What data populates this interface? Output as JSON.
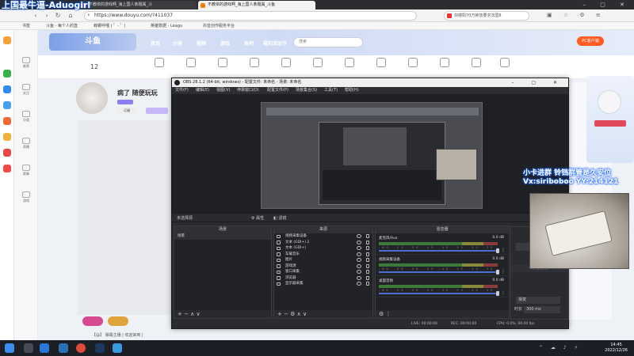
{
  "overlay": {
    "top_left_text": "上国最牛逼-Aduogirl",
    "cam_caption_line1": "小卡进群 铃铛群管是久安位",
    "cam_caption_line2": "Vx:siriboboo YY:214121"
  },
  "browser": {
    "tabs": [
      {
        "label": "不教依的游戏啊_海上国人条题属_斗"
      },
      {
        "label": "不教依的游戏啊_海上国人条题属_斗鱼"
      }
    ],
    "url": "https://www.douyu.com/?411037",
    "search_box": "剑楼阳70万钟放要求法国8",
    "bookmarks": [
      "书签",
      "斗鱼 - 每个人的直",
      "蝉螺呼哩 ( ゜- ゜)",
      "英雄数据 - Leagu",
      "抖音创作服务平台"
    ]
  },
  "douyu": {
    "nav": [
      "首页",
      "分类",
      "视频",
      "游戏",
      "鱼吧",
      "福利活动节"
    ],
    "search_placeholder": "搜索",
    "pc_download": "PC客户端",
    "sidebar": [
      "推荐",
      "关注",
      "分类",
      "直播",
      "赛事",
      "游戏",
      "视频"
    ],
    "level": "12",
    "stream_title": "病了 随便玩玩",
    "tool_labels": [
      "",
      "",
      "",
      "",
      "",
      "",
      "",
      "",
      "",
      "",
      "",
      "",
      "",
      "",
      ""
    ],
    "follow_label": "订阅",
    "bottom_bar": "【@】 弹幕主播 | 欢迎来到 |"
  },
  "obs": {
    "title": "OBS 28.1.2 (64-bit, windows) - 配置文件: 未命名 - 场景: 未命名",
    "menu": [
      "文件(F)",
      "编辑(E)",
      "视图(V)",
      "停靠窗口(D)",
      "配置文件(P)",
      "场景集合(S)",
      "工具(T)",
      "帮助(H)"
    ],
    "source_bar": "未选择源",
    "props_label": "属性",
    "filters_label": "滤镜",
    "docks": {
      "scenes": {
        "title": "场景",
        "items": [
          "场景"
        ]
      },
      "sources": {
        "title": "来源",
        "items": [
          "视频采集设备",
          "文本 (GDI+) 2",
          "文本 (GDI+)",
          "车载音乐",
          "图片",
          "游戏源",
          "窗口采集",
          "浏览器",
          "显示器采集"
        ]
      },
      "mixer": {
        "title": "混音器",
        "channels": [
          {
            "name": "麦克风/Aux",
            "db": "0.0 dB"
          },
          {
            "name": "视频采集设备",
            "db": "0.0 dB"
          },
          {
            "name": "桌面音频",
            "db": "0.0 dB"
          }
        ],
        "ticks": "-60 -55 -50 -45 -40 -35 -30 -25 -20 -15 -10 -5 0"
      },
      "controls": {
        "exit": "退出",
        "transition": "转场特效",
        "fade": "渐变",
        "duration_label": "时长",
        "duration": "300 ms"
      }
    },
    "status": {
      "live": "LIVE: 00:00:00",
      "rec": "REC: 00:00:00",
      "cpu": "CPU: 0.0%, 60.00 fps"
    }
  },
  "taskbar": {
    "time": "14:45",
    "date": "2022/12/26"
  }
}
